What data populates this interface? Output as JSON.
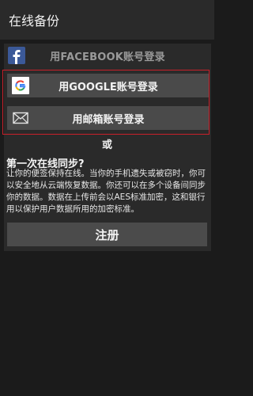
{
  "title": "在线备份",
  "facebook": {
    "label": "用FACEBOOK账号登录",
    "icon": "facebook-icon"
  },
  "google": {
    "label": "用GOOGLE账号登录",
    "icon": "google-icon"
  },
  "email": {
    "label": "用邮箱账号登录",
    "icon": "mail-icon"
  },
  "or": "或",
  "sync": {
    "title": "第一次在线同步?",
    "description": "让你的便签保持在线。当你的手机遗失或被窃时，你可以安全地从云端恢复数据。你还可以在多个设备间同步你的数据。数据在上传前会以AES标准加密，这和银行用以保护用户数据所用的加密标准。"
  },
  "register_label": "注册",
  "colors": {
    "highlight": "#c9202a",
    "facebook": "#3b5998",
    "google_red": "#ea4335",
    "google_blue": "#4285f4"
  }
}
